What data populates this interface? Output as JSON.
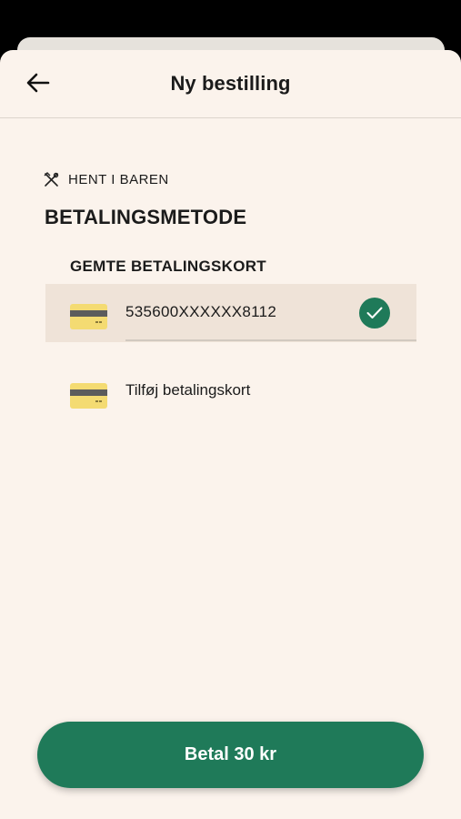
{
  "header": {
    "title": "Ny bestilling"
  },
  "pickup": {
    "label": "HENT I BAREN",
    "icon": "utensils-icon"
  },
  "payment": {
    "section_title": "BETALINGSMETODE",
    "saved_cards_title": "GEMTE BETALINGSKORT",
    "cards": [
      {
        "number": "535600XXXXXX8112",
        "selected": true
      }
    ],
    "add_card_label": "Tilføj betalingskort"
  },
  "pay_button": {
    "label": "Betal 30 kr"
  },
  "colors": {
    "accent": "#1f7a59",
    "background": "#fbf3ec",
    "selected_row": "#efe3d8",
    "card_yellow": "#f4db72"
  }
}
